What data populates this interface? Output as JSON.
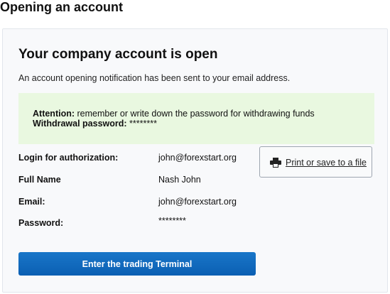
{
  "page": {
    "title": "Opening an account"
  },
  "card": {
    "title": "Your company account is open",
    "notification": "An account opening notification has been sent to your email address.",
    "attention": {
      "label": "Attention:",
      "text": " remember or write down the password for withdrawing funds",
      "password_label": "Withdrawal password:",
      "password_value": " ********"
    },
    "fields": [
      {
        "label": "Login for authorization:",
        "value": "john@forexstart.org"
      },
      {
        "label": "Full Name",
        "value": "Nash John"
      },
      {
        "label": "Email:",
        "value": "john@forexstart.org"
      },
      {
        "label": "Password:",
        "value": "********"
      }
    ],
    "print_button": {
      "label": "Print or save to a file",
      "icon": "printer-icon"
    },
    "terminal_button": {
      "label": "Enter the trading Terminal"
    }
  },
  "colors": {
    "attention_bg": "#e9f8e0",
    "primary_button": "#1170c4",
    "card_bg": "#f8f9fb"
  }
}
